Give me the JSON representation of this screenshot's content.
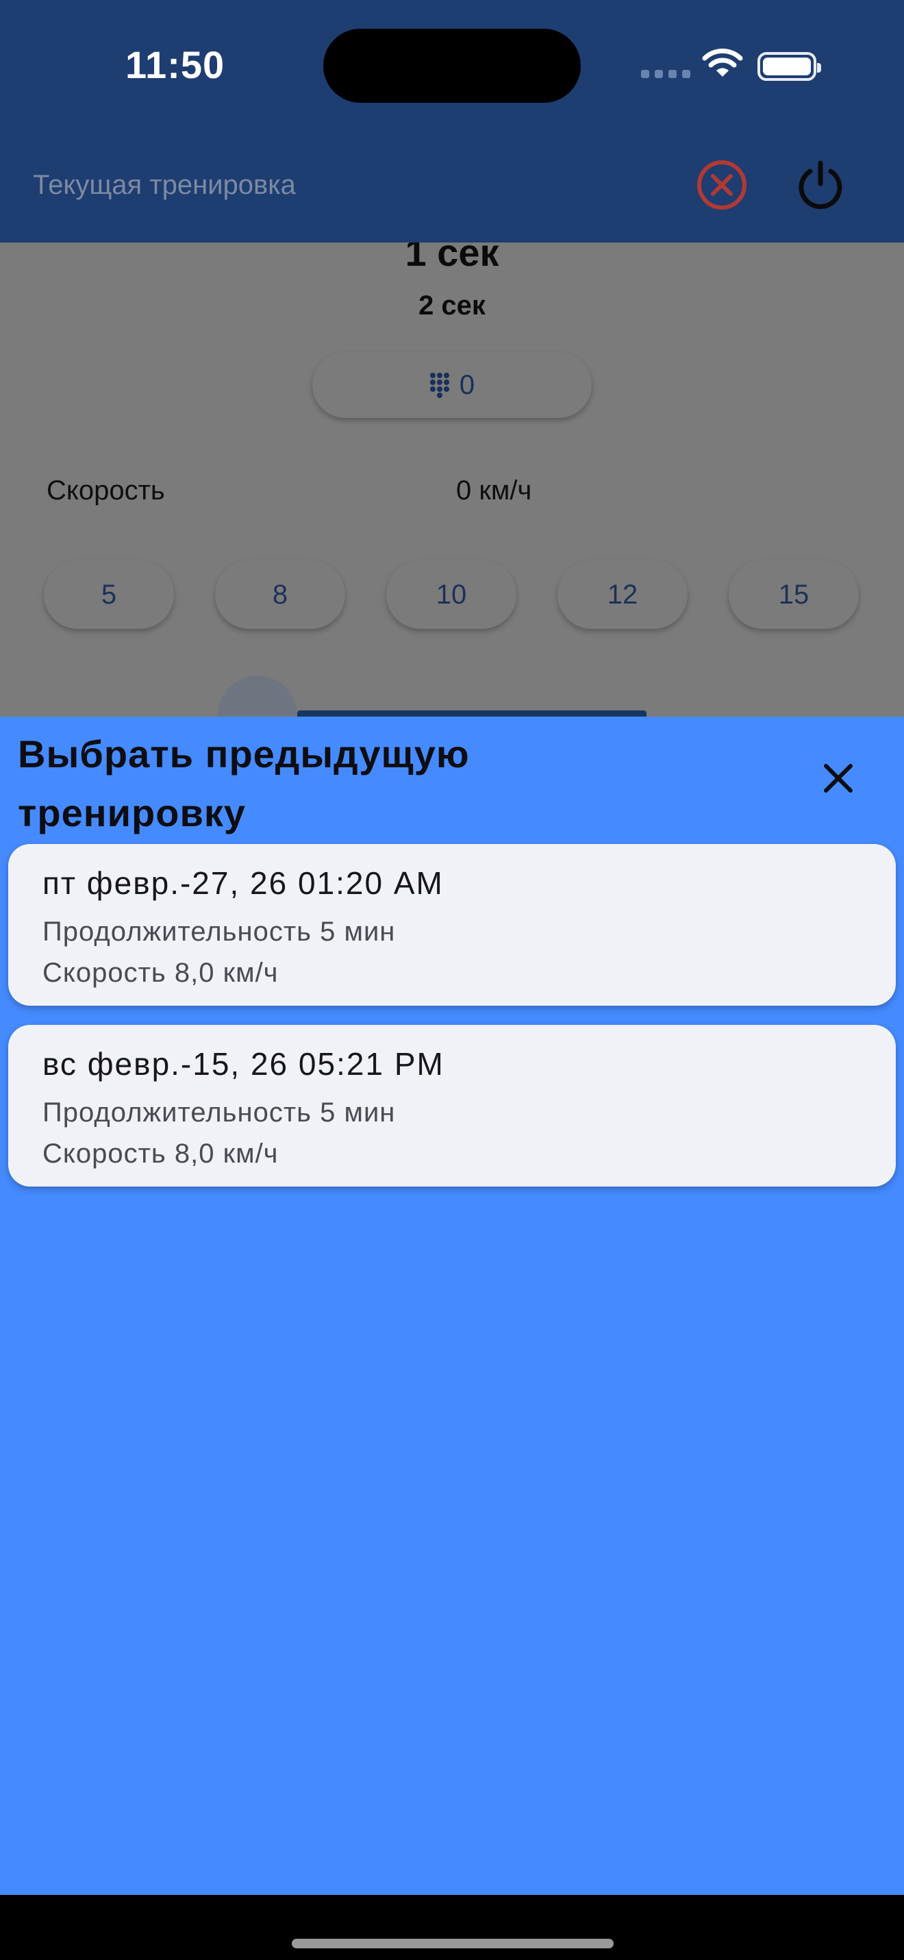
{
  "status_bar": {
    "time": "11:50"
  },
  "app_bar": {
    "title": "Текущая тренировка",
    "cancel_icon": "cancel-circle-icon",
    "power_icon": "power-icon",
    "colors": {
      "background": "#1e3d71",
      "cancel": "#c0392b"
    }
  },
  "workout": {
    "time_primary": "1 сек",
    "time_secondary": "2 сек",
    "counter_value": "0",
    "speed_label": "Скорость",
    "speed_value": "0 км/ч",
    "speed_presets": [
      "5",
      "8",
      "10",
      "12",
      "15"
    ]
  },
  "sheet": {
    "title": "Выбрать предыдущую тренировку",
    "background": "#458bff",
    "items": [
      {
        "date": "пт февр.-27, 26 01:20 AM",
        "duration": "Продолжительность 5 мин",
        "speed": "Скорость 8,0 км/ч"
      },
      {
        "date": "вс февр.-15, 26 05:21 PM",
        "duration": "Продолжительность 5 мин",
        "speed": "Скорость 8,0 км/ч"
      }
    ]
  }
}
